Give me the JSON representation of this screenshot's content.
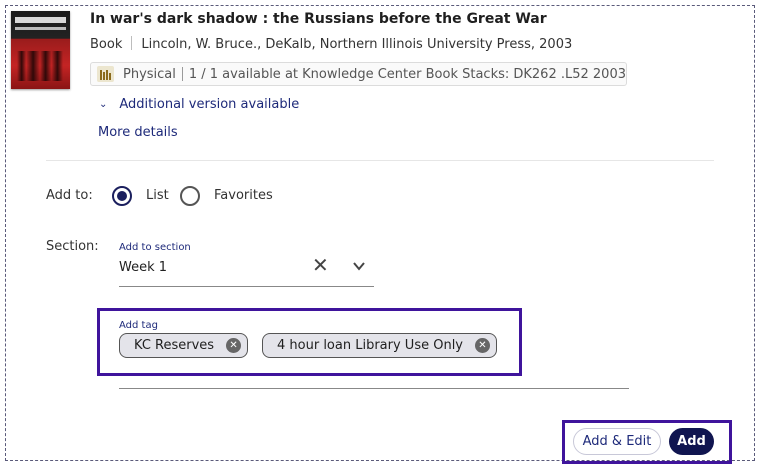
{
  "record": {
    "title": "In war's dark shadow : the Russians before the Great War",
    "type": "Book",
    "details": "Lincoln, W. Bruce., DeKalb, Northern Illinois University Press, 2003",
    "availability": {
      "format": "Physical",
      "status": "1 / 1 available at Knowledge Center Book Stacks: DK262 .L52 2003"
    },
    "additional_version": "Additional version available",
    "more_details": "More details"
  },
  "form": {
    "add_to_label": "Add to:",
    "options": [
      {
        "label": "List",
        "selected": true
      },
      {
        "label": "Favorites",
        "selected": false
      }
    ],
    "section_label": "Section:",
    "section_field_label": "Add to section",
    "section_value": "Week 1",
    "tag_field_label": "Add tag",
    "tags": [
      "KC Reserves",
      "4 hour loan Library Use Only"
    ]
  },
  "actions": {
    "add_edit_label": "Add & Edit",
    "add_label": "Add"
  },
  "colors": {
    "accent": "#101550",
    "link": "#1e2a7a",
    "highlight_border": "#3f149c"
  },
  "icons": [
    "book-cover-thumbnail",
    "library-icon",
    "chevron-down-icon",
    "clear-icon",
    "remove-tag-icon"
  ]
}
